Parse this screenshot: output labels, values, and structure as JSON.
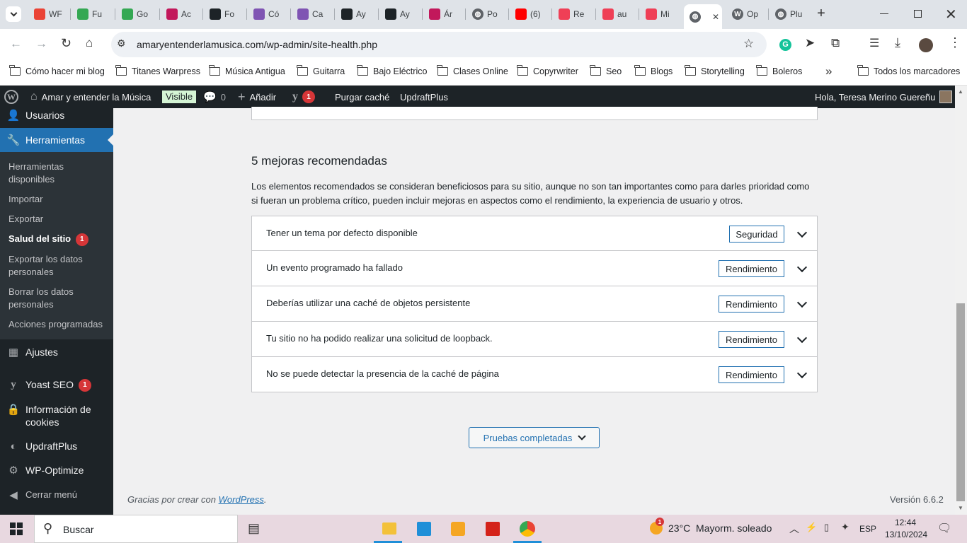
{
  "browser": {
    "tabs": [
      {
        "label": "WF",
        "icon": "gmail-icon",
        "color": "#ea4335"
      },
      {
        "label": "Fu",
        "icon": "google-drive-icon",
        "color": "#34a853"
      },
      {
        "label": "Go",
        "icon": "google-drive-icon",
        "color": "#34a853"
      },
      {
        "label": "Ac",
        "icon": "w-icon",
        "color": "#c2185b"
      },
      {
        "label": "Fo",
        "icon": "wix-icon",
        "color": "#1d2327"
      },
      {
        "label": "Có",
        "icon": "woo-icon",
        "color": "#7f54b3"
      },
      {
        "label": "Ca",
        "icon": "woo-icon",
        "color": "#7f54b3"
      },
      {
        "label": "Ay",
        "icon": "wix-icon",
        "color": "#1d2327"
      },
      {
        "label": "Ay",
        "icon": "wix-icon",
        "color": "#1d2327"
      },
      {
        "label": "Ár",
        "icon": "w-icon",
        "color": "#c2185b"
      },
      {
        "label": "Po",
        "icon": "globe-icon",
        "color": "#5f6368"
      },
      {
        "label": "(6)",
        "icon": "youtube-icon",
        "color": "#ff0000"
      },
      {
        "label": "Re",
        "icon": "pocket-icon",
        "color": "#ef3f56"
      },
      {
        "label": "au",
        "icon": "pocket-icon",
        "color": "#ef3f56"
      },
      {
        "label": "Mi",
        "icon": "pocket-icon",
        "color": "#ef3f56"
      },
      {
        "label": "",
        "icon": "globe-icon",
        "color": "#5f6368"
      },
      {
        "label": "Op",
        "icon": "wordpress-icon",
        "color": "#5f6368"
      },
      {
        "label": "Plu",
        "icon": "globe-icon",
        "color": "#5f6368"
      }
    ],
    "url": "amaryentenderlamusica.com/wp-admin/site-health.php",
    "bookmarks": [
      "Cómo hacer mi blog",
      "Titanes Warpress",
      "Música Antigua",
      "Guitarra",
      "Bajo Eléctrico",
      "Clases Online",
      "Copyrwriter",
      "Seo",
      "Blogs",
      "Storytelling",
      "Boleros"
    ],
    "bookmarks_more": "»",
    "all_bookmarks": "Todos los marcadores"
  },
  "adminbar": {
    "site_name": "Amar y entender la Música",
    "visible_label": "Visible",
    "comments_count": "0",
    "add_label": "Añadir",
    "yoast_count": "1",
    "purge_label": "Purgar caché",
    "updraft_label": "UpdraftPlus",
    "greeting": "Hola, Teresa Merino Guereñu"
  },
  "sidebar": {
    "users": "Usuarios",
    "tools": "Herramientas",
    "submenu": [
      "Herramientas disponibles",
      "Importar",
      "Exportar",
      "Salud del sitio",
      "Exportar los datos personales",
      "Borrar los datos personales",
      "Acciones programadas"
    ],
    "site_health_badge": "1",
    "settings": "Ajustes",
    "yoast": "Yoast SEO",
    "yoast_badge": "1",
    "cookies": "Información de cookies",
    "updraft": "UpdraftPlus",
    "wpoptimize": "WP-Optimize",
    "collapse": "Cerrar menú"
  },
  "main": {
    "heading": "5 mejoras recomendadas",
    "description": "Los elementos recomendados se consideran beneficiosos para su sitio, aunque no son tan importantes como para darles prioridad como si fueran un problema crítico, pueden incluir mejoras en aspectos como el rendimiento, la experiencia de usuario y otros.",
    "items": [
      {
        "title": "Tener un tema por defecto disponible",
        "tag": "Seguridad"
      },
      {
        "title": "Un evento programado ha fallado",
        "tag": "Rendimiento"
      },
      {
        "title": "Deberías utilizar una caché de objetos persistente",
        "tag": "Rendimiento"
      },
      {
        "title": "Tu sitio no ha podido realizar una solicitud de loopback.",
        "tag": "Rendimiento"
      },
      {
        "title": "No se puede detectar la presencia de la caché de página",
        "tag": "Rendimiento"
      }
    ],
    "passed_button": "Pruebas completadas",
    "footer_text": "Gracias por crear con ",
    "footer_link": "WordPress",
    "footer_period": ".",
    "version": "Versión 6.6.2"
  },
  "taskbar": {
    "search_placeholder": "Buscar",
    "weather": "23°C  Mayorm. soleado",
    "weather_badge": "1",
    "lang": "ESP",
    "time": "12:44",
    "date": "13/10/2024"
  }
}
